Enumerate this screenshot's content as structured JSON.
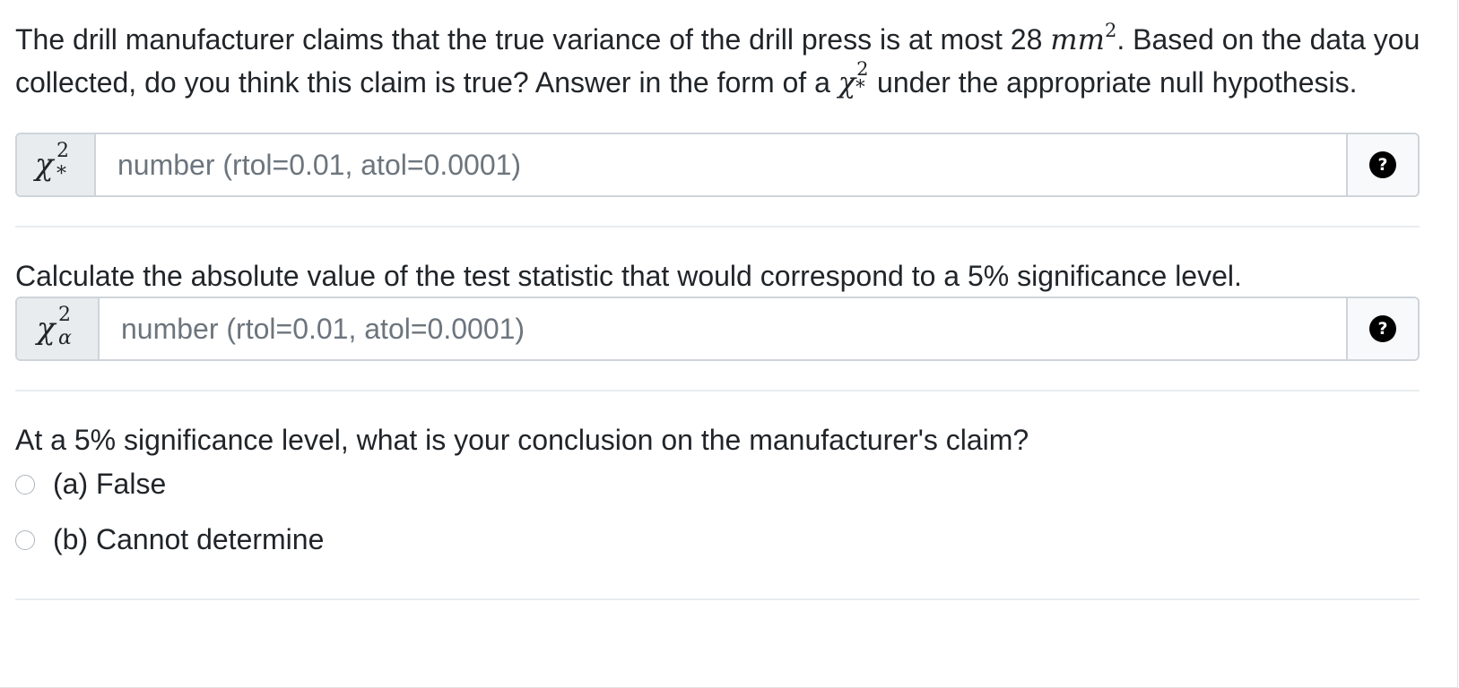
{
  "question1": {
    "text_part1": "The drill manufacturer claims that the true variance of the drill press is at most 28 ",
    "unit_base": "mm",
    "unit_exponent": "2",
    "text_part2": ". Based on the data you collected, do you think this claim is true? Answer in the form of a ",
    "symbol": "χ",
    "symbol_sup": "2",
    "symbol_sub": "*",
    "text_part3": " under the appropriate null hypothesis.",
    "input": {
      "symbol": "χ",
      "symbol_sup": "2",
      "symbol_sub": "*",
      "placeholder": "number (rtol=0.01, atol=0.0001)",
      "value": "",
      "help_icon": "?"
    }
  },
  "question2": {
    "text": "Calculate the absolute value of the test statistic that would correspond to a 5% significance level.",
    "input": {
      "symbol": "χ",
      "symbol_sup": "2",
      "symbol_sub": "α",
      "placeholder": "number (rtol=0.01, atol=0.0001)",
      "value": "",
      "help_icon": "?"
    }
  },
  "question3": {
    "text": "At a 5% significance level, what is your conclusion on the manufacturer's claim?",
    "options": [
      {
        "label": "(a) False",
        "selected": false
      },
      {
        "label": "(b) Cannot determine",
        "selected": false
      }
    ]
  },
  "icons": {
    "help": "question-circle-icon",
    "radio": "radio-unchecked-icon"
  },
  "colors": {
    "addon_bg": "#e9ecef",
    "border": "#ced4da",
    "help_icon_bg": "#000000",
    "divider": "#e9ecef"
  }
}
